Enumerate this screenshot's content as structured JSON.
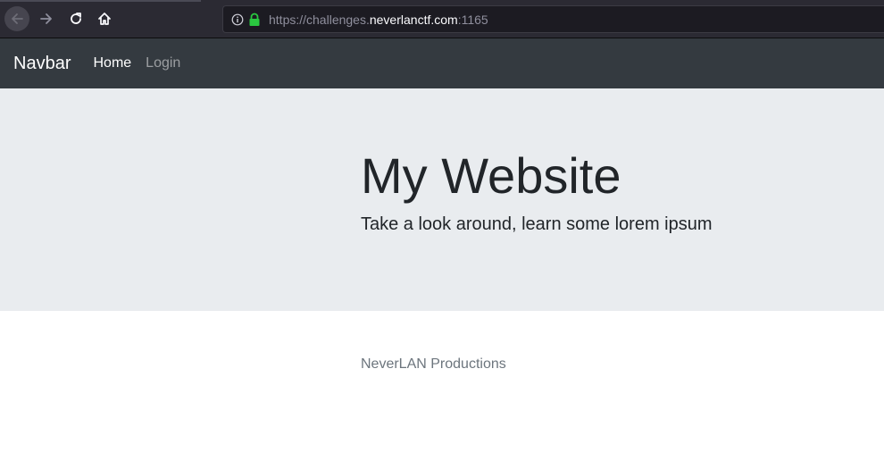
{
  "browser": {
    "url_prefix": "https://challenges.",
    "url_host": "neverlanctf.com",
    "url_port": ":1165",
    "icons": [
      "back-arrow-icon",
      "forward-arrow-icon",
      "reload-icon",
      "home-icon",
      "info-icon",
      "lock-icon"
    ]
  },
  "navbar": {
    "brand": "Navbar",
    "links": [
      {
        "label": "Home"
      },
      {
        "label": "Login"
      }
    ]
  },
  "jumbotron": {
    "title": "My Website",
    "lead": "Take a look around, learn some lorem ipsum"
  },
  "footer": {
    "text": "NeverLAN Productions"
  },
  "colors": {
    "navbar_bg": "#343a40",
    "jumbotron_bg": "#e9ecef",
    "lock_green": "#2ac840"
  }
}
